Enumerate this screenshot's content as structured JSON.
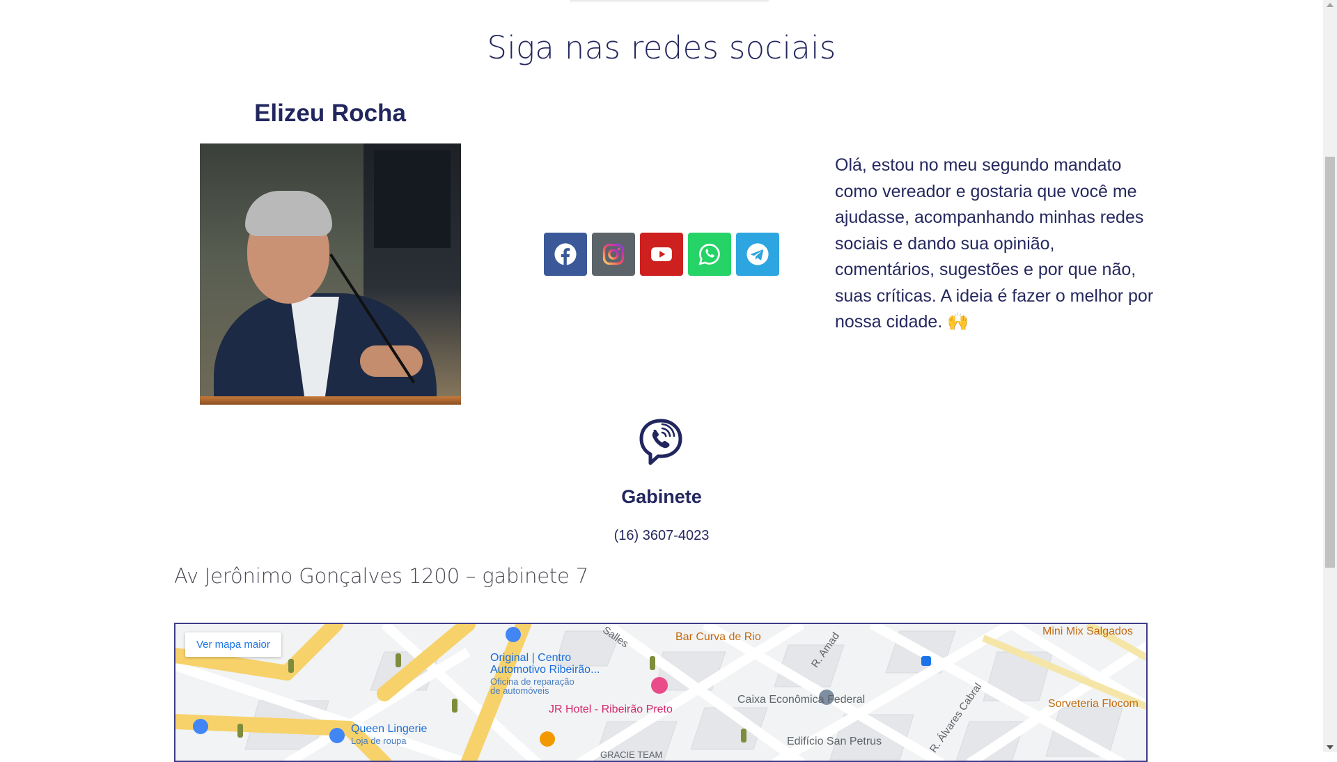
{
  "section": {
    "title": "Siga nas redes sociais"
  },
  "profile": {
    "name": "Elizeu Rocha",
    "photo_alt": "Elizeu Rocha"
  },
  "social": [
    {
      "name": "facebook",
      "icon": "facebook-icon",
      "color": "#3b5998"
    },
    {
      "name": "instagram",
      "icon": "instagram-icon",
      "color": "#5c6369"
    },
    {
      "name": "youtube",
      "icon": "youtube-icon",
      "color": "#cd201f"
    },
    {
      "name": "whatsapp",
      "icon": "whatsapp-icon",
      "color": "#25d366"
    },
    {
      "name": "telegram",
      "icon": "telegram-icon",
      "color": "#2ca5e0"
    }
  ],
  "bio": {
    "text": "Olá, estou no meu segundo mandato como vereador e gostaria que você me ajudasse, acompanhando minhas redes sociais e dando sua opinião, comentários, sugestões e por que não, suas críticas. A ideia é fazer o melhor por nossa cidade. 🙌"
  },
  "contact": {
    "title": "Gabinete",
    "phone": "(16) 3607-4023",
    "address": "Av Jerônimo Gonçalves 1200 – gabinete 7"
  },
  "map": {
    "button_label": "Ver mapa maior",
    "places": {
      "bar": "Bar Curva de Rio",
      "mini_mix": "Mini Mix Salgados",
      "original_1": "Original | Centro",
      "original_2": "Automotivo Ribeirão...",
      "original_sub_1": "Oficina de reparação",
      "original_sub_2": "de automóveis",
      "jr_hotel": "JR Hotel - Ribeirão Preto",
      "caixa": "Caixa Econômica Federal",
      "sorveteria": "Sorveteria Flocom",
      "queen": "Queen Lingerie",
      "queen_sub": "Loja de roupa",
      "edificio": "Edifício San Petrus",
      "gracie": "GRACIE TEAM"
    },
    "roads": {
      "salles": "Salles",
      "amador": "R. Amad",
      "alvares": "R. Álvares Cabral"
    }
  }
}
